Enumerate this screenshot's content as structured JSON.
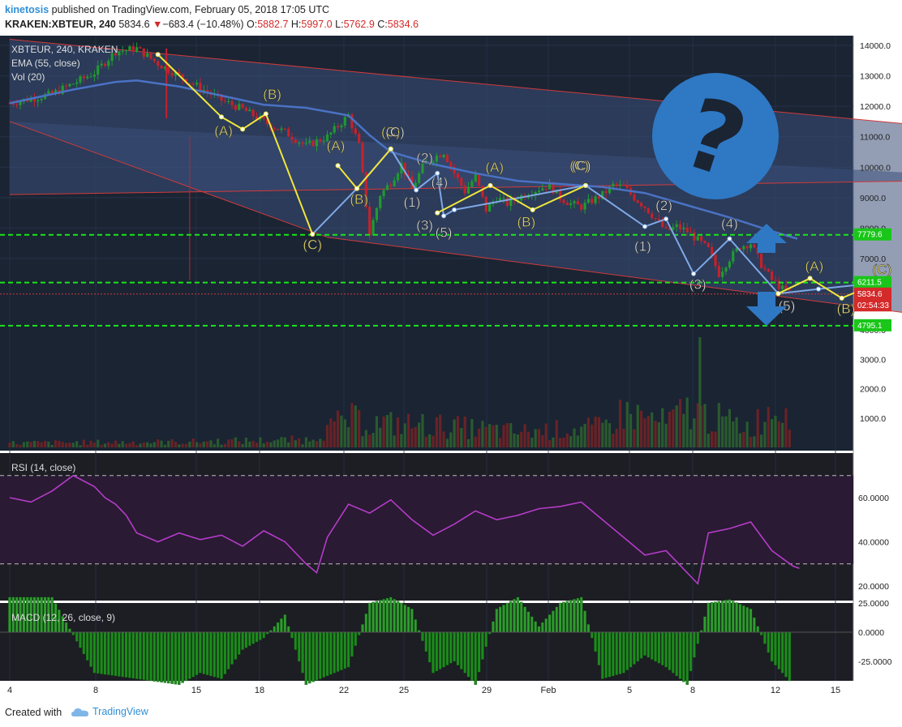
{
  "header": {
    "user": "kinetosis",
    "published_text": "published on TradingView.com, February 05, 2018 17:05 UTC",
    "symbol": "KRAKEN:XBTEUR, 240",
    "last": "5834.6",
    "arrow": "▼",
    "change": "−683.4 (−10.48%)",
    "o_label": "O:",
    "o_value": "5882.7",
    "h_label": "H:",
    "h_value": "5997.0",
    "l_label": "L:",
    "l_value": "5762.9",
    "c_label": "C:",
    "c_value": "5834.6"
  },
  "footer": {
    "created_with": "Created with",
    "brand": "TradingView"
  },
  "colors": {
    "panel_bg": "#1a2433",
    "channel_fill": "#3a4e78",
    "channel_edge": "#d23a3a",
    "ema": "#4a72c4",
    "up": "#1f9a30",
    "down": "#c4222c",
    "green_level": "#19e619",
    "wave_yellow": "#f0e63c",
    "wave_blue": "#7fa8e6",
    "rsi": "#b43cc8",
    "rsi_bg": "#2a1a33",
    "macd_hist": "#1c8c1c",
    "question_bubble": "#2f78c4"
  },
  "icons": {
    "question": "question-mark-icon",
    "up_arrow": "arrow-up-icon",
    "down_arrow": "arrow-down-icon",
    "logo": "tradingview-cloud-icon"
  },
  "chart_data": [
    {
      "type": "candlestick",
      "title": "XBTEUR, 240, KRAKEN",
      "legend": [
        "XBTEUR, 240, KRAKEN",
        "EMA (55, close)",
        "Vol (20)"
      ],
      "x_ticks": [
        "4",
        "8",
        "15",
        "18",
        "22",
        "25",
        "29",
        "Feb",
        "5",
        "8",
        "12",
        "15"
      ],
      "y_ticks": [
        "14000.0",
        "13000.0",
        "12000.0",
        "11000.0",
        "10000.0",
        "9000.0",
        "8000.0",
        "7000.0"
      ],
      "ylim": [
        4600,
        14300
      ],
      "price_tags": [
        {
          "label": "7779.6",
          "value": 7779.6
        },
        {
          "label": "6211.5",
          "value": 6211.5
        },
        {
          "label": "5834.6",
          "value": 5834.6
        },
        {
          "label": "02:54:33",
          "value": 5450
        },
        {
          "label": "4795.1",
          "value": 4795.1
        }
      ],
      "horizontal_levels": [
        7779.6,
        6211.5,
        4795.1
      ],
      "close_path": [
        [
          0,
          12100
        ],
        [
          2,
          12400
        ],
        [
          4,
          13100
        ],
        [
          5,
          13800
        ],
        [
          6,
          13900
        ],
        [
          7,
          13400
        ],
        [
          8,
          13000
        ],
        [
          9,
          12600
        ],
        [
          10,
          12200
        ],
        [
          11,
          11900
        ],
        [
          12,
          11500
        ],
        [
          13,
          11150
        ],
        [
          14,
          10700
        ],
        [
          15,
          11000
        ],
        [
          16,
          11700
        ],
        [
          16.5,
          10700
        ],
        [
          17,
          7800
        ],
        [
          17.5,
          9100
        ],
        [
          18,
          9500
        ],
        [
          18.5,
          10100
        ],
        [
          19,
          9300
        ],
        [
          19.5,
          10000
        ],
        [
          20,
          10300
        ],
        [
          20.5,
          10500
        ],
        [
          21,
          9800
        ],
        [
          21.5,
          9200
        ],
        [
          22,
          9700
        ],
        [
          22.5,
          8600
        ],
        [
          23,
          9000
        ],
        [
          23.5,
          8800
        ],
        [
          24,
          9000
        ],
        [
          25,
          9300
        ],
        [
          25.5,
          9400
        ],
        [
          26,
          9000
        ],
        [
          26.5,
          8800
        ],
        [
          27,
          8700
        ],
        [
          28,
          9100
        ],
        [
          28.5,
          9400
        ],
        [
          29,
          9350
        ],
        [
          29.5,
          9000
        ],
        [
          30,
          8700
        ],
        [
          30.5,
          8300
        ],
        [
          31,
          7900
        ],
        [
          31.5,
          8050
        ],
        [
          32,
          7900
        ],
        [
          33,
          7300
        ],
        [
          33.5,
          6500
        ],
        [
          34,
          7000
        ],
        [
          34.5,
          7400
        ],
        [
          35,
          7500
        ],
        [
          35.5,
          6800
        ],
        [
          36,
          6300
        ],
        [
          36.5,
          6000
        ],
        [
          37,
          5834.6
        ]
      ],
      "ema_path": [
        [
          0,
          12100
        ],
        [
          3,
          12550
        ],
        [
          5,
          12800
        ],
        [
          6,
          12850
        ],
        [
          8,
          12650
        ],
        [
          10,
          12350
        ],
        [
          12,
          12050
        ],
        [
          14,
          11950
        ],
        [
          16,
          11700
        ],
        [
          17,
          11050
        ],
        [
          18,
          10500
        ],
        [
          20,
          10100
        ],
        [
          22,
          9800
        ],
        [
          24,
          9550
        ],
        [
          26,
          9450
        ],
        [
          28,
          9350
        ],
        [
          30,
          9150
        ],
        [
          32,
          8750
        ],
        [
          34,
          8350
        ],
        [
          36,
          7900
        ],
        [
          37.2,
          7650
        ]
      ],
      "channel_upper": {
        "from": [
          0,
          14200
        ],
        "to": [
          48,
          11050
        ]
      },
      "channel_mid": {
        "from": [
          0,
          9100
        ],
        "to": [
          48,
          9600
        ]
      },
      "channel_lower": {
        "from": [
          15,
          7700
        ],
        "to": [
          48,
          4700
        ]
      },
      "channel_lower_start": {
        "from": [
          0,
          11500
        ],
        "to": [
          15,
          7700
        ]
      },
      "wave_yellow": [
        [
          7,
          13700
        ],
        [
          10,
          11650
        ],
        [
          11,
          11250
        ],
        [
          12.1,
          11750
        ],
        [
          14.3,
          7800
        ]
      ],
      "wave_yellow2": [
        [
          15.5,
          10050
        ],
        [
          16.4,
          9300
        ],
        [
          18,
          10600
        ]
      ],
      "wave_yellow3": [
        [
          20.2,
          8500
        ],
        [
          22.7,
          9400
        ],
        [
          24.7,
          8600
        ],
        [
          27.2,
          9400
        ]
      ],
      "wave_blue": [
        [
          14.3,
          7800
        ],
        [
          16.4,
          9300
        ],
        [
          18,
          10600
        ],
        [
          19.2,
          9250
        ],
        [
          20.2,
          9800
        ],
        [
          20.5,
          8400
        ],
        [
          21,
          8600
        ],
        [
          27.2,
          9400
        ],
        [
          30,
          8050
        ],
        [
          31,
          8300
        ],
        [
          32.3,
          6500
        ],
        [
          34,
          7650
        ],
        [
          36.3,
          5850
        ],
        [
          38.2,
          6000
        ],
        [
          41,
          6200
        ]
      ],
      "wave_yellow_future": [
        [
          36.3,
          5850
        ],
        [
          37.8,
          6350
        ],
        [
          39.3,
          5700
        ],
        [
          41,
          6200
        ]
      ],
      "wave_labels": [
        {
          "text": "(A)",
          "x": 10.1,
          "y": 11050,
          "color": "yellow"
        },
        {
          "text": "(B)",
          "x": 12.4,
          "y": 12250,
          "color": "yellow"
        },
        {
          "text": "(C)",
          "x": 14.3,
          "y": 7300,
          "color": "yellow"
        },
        {
          "text": "(A)",
          "x": 15.4,
          "y": 10550,
          "color": "yellow"
        },
        {
          "text": "(B)",
          "x": 16.5,
          "y": 8800,
          "color": "yellow"
        },
        {
          "text": "(C)",
          "x": 18.0,
          "y": 11000,
          "color": "yellow"
        },
        {
          "text": "(C)",
          "x": 18.2,
          "y": 11000,
          "color": "white"
        },
        {
          "text": "(2)",
          "x": 19.6,
          "y": 10150,
          "color": "white"
        },
        {
          "text": "(1)",
          "x": 19.0,
          "y": 8700,
          "color": "white"
        },
        {
          "text": "(4)",
          "x": 20.3,
          "y": 9350,
          "color": "white"
        },
        {
          "text": "(3)",
          "x": 19.6,
          "y": 7950,
          "color": "white"
        },
        {
          "text": "(5)",
          "x": 20.5,
          "y": 7700,
          "color": "white"
        },
        {
          "text": "(A)",
          "x": 22.9,
          "y": 9850,
          "color": "yellow"
        },
        {
          "text": "(B)",
          "x": 24.4,
          "y": 8050,
          "color": "yellow"
        },
        {
          "text": "(C)",
          "x": 26.9,
          "y": 9900,
          "color": "yellow"
        },
        {
          "text": "(C)",
          "x": 27.0,
          "y": 9900,
          "color": "white"
        },
        {
          "text": "(2)",
          "x": 30.9,
          "y": 8600,
          "color": "white"
        },
        {
          "text": "(1)",
          "x": 29.9,
          "y": 7250,
          "color": "white"
        },
        {
          "text": "(4)",
          "x": 34.0,
          "y": 8000,
          "color": "white"
        },
        {
          "text": "(3)",
          "x": 32.5,
          "y": 6000,
          "color": "white"
        },
        {
          "text": "(5)",
          "x": 36.7,
          "y": 5300,
          "color": "white"
        },
        {
          "text": "(A)",
          "x": 38.0,
          "y": 6600,
          "color": "yellow"
        },
        {
          "text": "(B)",
          "x": 39.5,
          "y": 5200,
          "color": "yellow"
        },
        {
          "text": "(C)",
          "x": 41.2,
          "y": 6500,
          "color": "yellow"
        }
      ]
    },
    {
      "type": "bar",
      "title": "Vol (20)",
      "y_ticks": [
        "4000.0",
        "3000.0",
        "2000.0",
        "1000.0"
      ],
      "ylim": [
        0,
        5000
      ],
      "spike": {
        "x": 32.6,
        "value": 3750
      },
      "values_profile": [
        [
          0,
          200
        ],
        [
          8,
          250
        ],
        [
          14,
          350
        ],
        [
          16,
          1300
        ],
        [
          17,
          1100
        ],
        [
          20,
          1000
        ],
        [
          24,
          700
        ],
        [
          28,
          900
        ],
        [
          29,
          1600
        ],
        [
          31,
          1100
        ],
        [
          32,
          1700
        ],
        [
          33,
          1400
        ],
        [
          35,
          900
        ],
        [
          36,
          1800
        ],
        [
          37,
          2000
        ]
      ]
    },
    {
      "type": "line",
      "title": "RSI (14, close)",
      "y_ticks": [
        "60.0000",
        "40.0000",
        "20.0000"
      ],
      "ylim": [
        15,
        78
      ],
      "bands": [
        70,
        30
      ],
      "values": [
        [
          0,
          60
        ],
        [
          1,
          58
        ],
        [
          2,
          63
        ],
        [
          3,
          70
        ],
        [
          4,
          65
        ],
        [
          4.5,
          60
        ],
        [
          5,
          57
        ],
        [
          5.5,
          52
        ],
        [
          6,
          44
        ],
        [
          7,
          40
        ],
        [
          8,
          44
        ],
        [
          9,
          41
        ],
        [
          10,
          43
        ],
        [
          11,
          38
        ],
        [
          12,
          45
        ],
        [
          13,
          40
        ],
        [
          14,
          30
        ],
        [
          14.5,
          26
        ],
        [
          15,
          42
        ],
        [
          16,
          57
        ],
        [
          17,
          53
        ],
        [
          18,
          59
        ],
        [
          19,
          50
        ],
        [
          20,
          43
        ],
        [
          21,
          48
        ],
        [
          22,
          54
        ],
        [
          23,
          50
        ],
        [
          24,
          52
        ],
        [
          25,
          55
        ],
        [
          26,
          56
        ],
        [
          27,
          58
        ],
        [
          28,
          50
        ],
        [
          29,
          42
        ],
        [
          30,
          34
        ],
        [
          31,
          36
        ],
        [
          32,
          26
        ],
        [
          32.5,
          21
        ],
        [
          33,
          44
        ],
        [
          34,
          46
        ],
        [
          35,
          49
        ],
        [
          36,
          36
        ],
        [
          37,
          29
        ],
        [
          37.3,
          28
        ]
      ]
    },
    {
      "type": "bar",
      "title": "MACD (12, 26, close, 9)",
      "y_ticks": [
        "25.0000",
        "0.0000",
        "-25.0000"
      ],
      "ylim": [
        -45,
        28
      ],
      "histogram": [
        [
          0,
          30
        ],
        [
          2,
          30
        ],
        [
          4,
          -35
        ],
        [
          6,
          -40
        ],
        [
          8,
          -45
        ],
        [
          9,
          -35
        ],
        [
          10,
          -40
        ],
        [
          11,
          -15
        ],
        [
          12,
          -5
        ],
        [
          13,
          15
        ],
        [
          14,
          -45
        ],
        [
          16,
          -30
        ],
        [
          17,
          25
        ],
        [
          18,
          30
        ],
        [
          19,
          20
        ],
        [
          20,
          -35
        ],
        [
          21,
          -25
        ],
        [
          22,
          -45
        ],
        [
          23,
          20
        ],
        [
          24,
          30
        ],
        [
          25,
          5
        ],
        [
          26,
          25
        ],
        [
          27,
          30
        ],
        [
          28,
          -40
        ],
        [
          29,
          -35
        ],
        [
          30,
          -20
        ],
        [
          31,
          -30
        ],
        [
          32,
          -45
        ],
        [
          33,
          25
        ],
        [
          34,
          28
        ],
        [
          35,
          20
        ],
        [
          36,
          -25
        ],
        [
          37,
          -45
        ]
      ]
    }
  ]
}
